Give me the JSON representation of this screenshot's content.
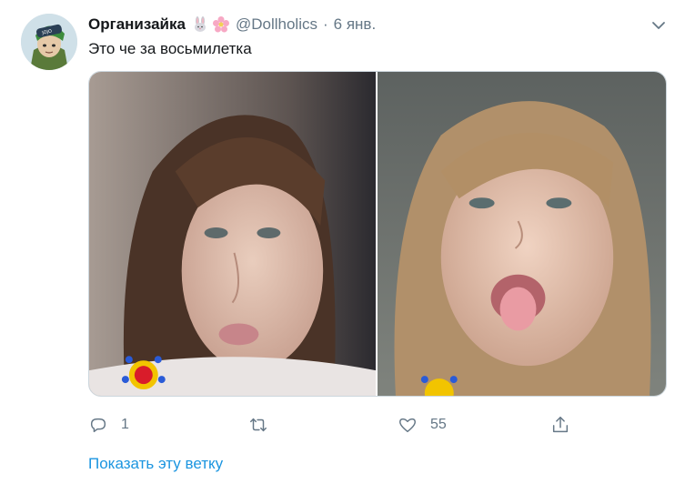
{
  "tweet": {
    "author_name": "Организайка",
    "author_emoji": [
      "rabbit-emoji",
      "cherry-blossom-emoji"
    ],
    "handle": "@Dollholics",
    "separator": "·",
    "time": "6 янв.",
    "text": "Это че за восьмилетка",
    "actions": {
      "reply_count": "1",
      "retweet_count": "",
      "like_count": "55"
    },
    "show_thread": "Показать эту ветку"
  },
  "colors": {
    "text": "#14171a",
    "secondary": "#657786",
    "link": "#1b95e0",
    "border": "#ccd6dd"
  },
  "icons": {
    "caret": "chevron-down-icon",
    "reply": "reply-icon",
    "retweet": "retweet-icon",
    "like": "heart-icon",
    "share": "share-icon"
  }
}
